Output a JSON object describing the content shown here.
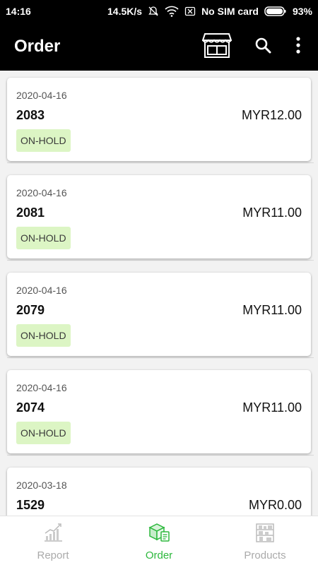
{
  "status_bar": {
    "time": "14:16",
    "speed": "14.5K/s",
    "sim": "No SIM card",
    "battery": "93%"
  },
  "header": {
    "title": "Order",
    "icons": [
      "store-icon",
      "search-icon",
      "more-vert-icon"
    ]
  },
  "orders": [
    {
      "date": "2020-04-16",
      "id": "2083",
      "amount": "MYR12.00",
      "status": "ON-HOLD"
    },
    {
      "date": "2020-04-16",
      "id": "2081",
      "amount": "MYR11.00",
      "status": "ON-HOLD"
    },
    {
      "date": "2020-04-16",
      "id": "2079",
      "amount": "MYR11.00",
      "status": "ON-HOLD"
    },
    {
      "date": "2020-04-16",
      "id": "2074",
      "amount": "MYR11.00",
      "status": "ON-HOLD"
    },
    {
      "date": "2020-03-18",
      "id": "1529",
      "amount": "MYR0.00",
      "status": ""
    }
  ],
  "bottom_nav": {
    "items": [
      {
        "label": "Report",
        "icon": "chart-icon",
        "active": false
      },
      {
        "label": "Order",
        "icon": "box-icon",
        "active": true
      },
      {
        "label": "Products",
        "icon": "shelves-icon",
        "active": false
      }
    ]
  },
  "colors": {
    "accent": "#2db83d",
    "badge_onhold": "#dcf5c4",
    "app_bar": "#000000"
  }
}
